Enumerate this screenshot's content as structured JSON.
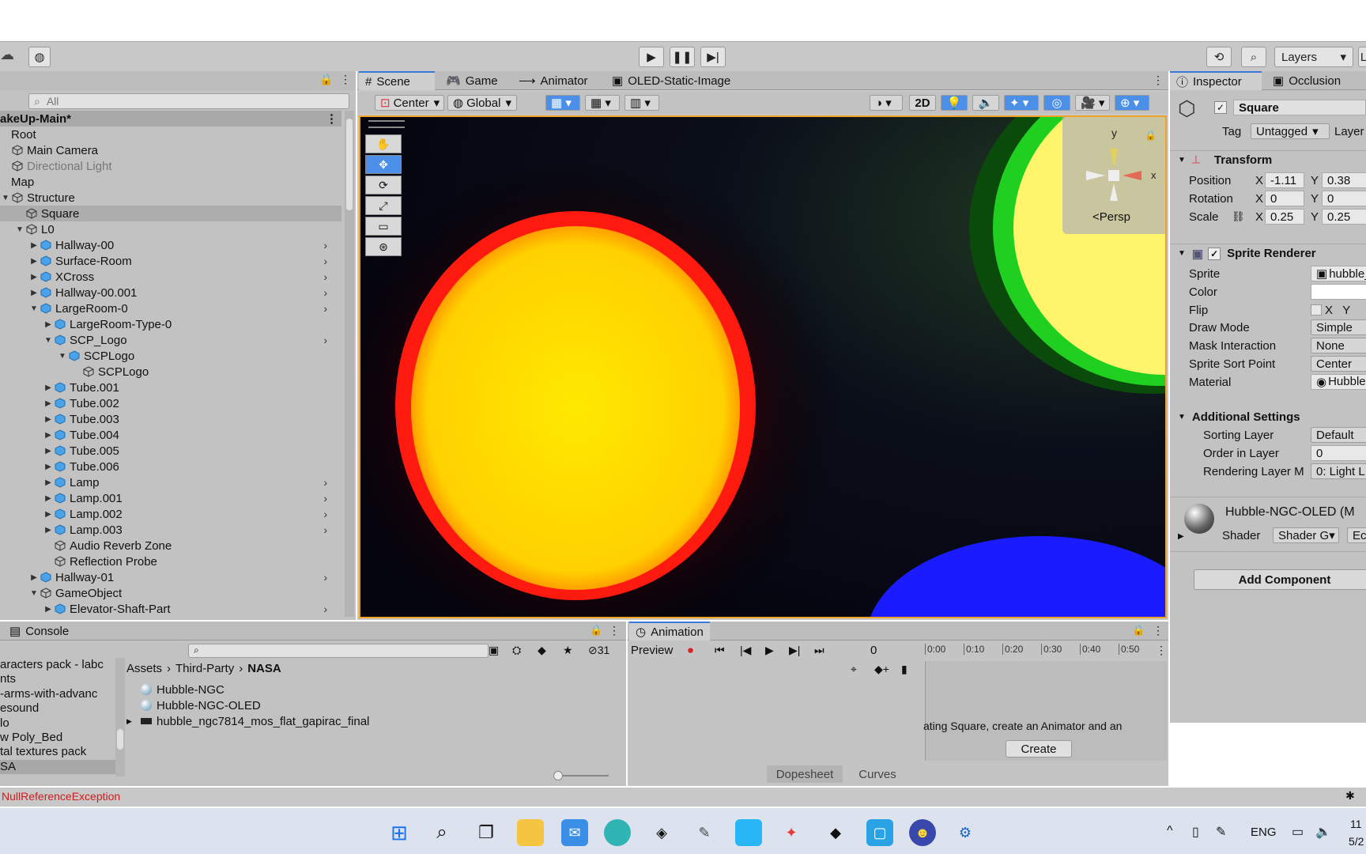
{
  "toolbar": {
    "layers_label": "Layers",
    "play_icon": "play-icon",
    "pause_icon": "pause-icon",
    "step_icon": "step-icon"
  },
  "hierarchy": {
    "search_placeholder": "All",
    "scene_name": "akeUp-Main*",
    "items": [
      {
        "label": "Root",
        "indent": 0,
        "arrow": "",
        "kind": "none",
        "more": false,
        "dim": false
      },
      {
        "label": "Main Camera",
        "indent": 0,
        "arrow": "",
        "kind": "cube",
        "more": false,
        "dim": false
      },
      {
        "label": "Directional Light",
        "indent": 0,
        "arrow": "",
        "kind": "cube",
        "more": false,
        "dim": true
      },
      {
        "label": "Map",
        "indent": 0,
        "arrow": "",
        "kind": "none",
        "more": false,
        "dim": false
      },
      {
        "label": "Structure",
        "indent": 0,
        "arrow": "▼",
        "kind": "cube",
        "more": false,
        "dim": false
      },
      {
        "label": "Square",
        "indent": 1,
        "arrow": "",
        "kind": "cube",
        "more": false,
        "dim": false,
        "selected": true
      },
      {
        "label": "L0",
        "indent": 1,
        "arrow": "▼",
        "kind": "cube",
        "more": false,
        "dim": false
      },
      {
        "label": "Hallway-00",
        "indent": 2,
        "arrow": "▶",
        "kind": "prefab",
        "more": true,
        "dim": false
      },
      {
        "label": "Surface-Room",
        "indent": 2,
        "arrow": "▶",
        "kind": "prefab",
        "more": true,
        "dim": false
      },
      {
        "label": "XCross",
        "indent": 2,
        "arrow": "▶",
        "kind": "prefab",
        "more": true,
        "dim": false
      },
      {
        "label": "Hallway-00.001",
        "indent": 2,
        "arrow": "▶",
        "kind": "prefab",
        "more": true,
        "dim": false
      },
      {
        "label": "LargeRoom-0",
        "indent": 2,
        "arrow": "▼",
        "kind": "prefab",
        "more": true,
        "dim": false
      },
      {
        "label": "LargeRoom-Type-0",
        "indent": 3,
        "arrow": "▶",
        "kind": "prefab",
        "more": false,
        "dim": false
      },
      {
        "label": "SCP_Logo",
        "indent": 3,
        "arrow": "▼",
        "kind": "prefab",
        "more": true,
        "dim": false
      },
      {
        "label": "SCPLogo",
        "indent": 4,
        "arrow": "▼",
        "kind": "prefab",
        "more": false,
        "dim": false
      },
      {
        "label": "SCPLogo",
        "indent": 5,
        "arrow": "",
        "kind": "cube",
        "more": false,
        "dim": false
      },
      {
        "label": "Tube.001",
        "indent": 3,
        "arrow": "▶",
        "kind": "prefab",
        "more": false,
        "dim": false
      },
      {
        "label": "Tube.002",
        "indent": 3,
        "arrow": "▶",
        "kind": "prefab",
        "more": false,
        "dim": false
      },
      {
        "label": "Tube.003",
        "indent": 3,
        "arrow": "▶",
        "kind": "prefab",
        "more": false,
        "dim": false
      },
      {
        "label": "Tube.004",
        "indent": 3,
        "arrow": "▶",
        "kind": "prefab",
        "more": false,
        "dim": false
      },
      {
        "label": "Tube.005",
        "indent": 3,
        "arrow": "▶",
        "kind": "prefab",
        "more": false,
        "dim": false
      },
      {
        "label": "Tube.006",
        "indent": 3,
        "arrow": "▶",
        "kind": "prefab",
        "more": false,
        "dim": false
      },
      {
        "label": "Lamp",
        "indent": 3,
        "arrow": "▶",
        "kind": "prefab",
        "more": true,
        "dim": false
      },
      {
        "label": "Lamp.001",
        "indent": 3,
        "arrow": "▶",
        "kind": "prefab",
        "more": true,
        "dim": false
      },
      {
        "label": "Lamp.002",
        "indent": 3,
        "arrow": "▶",
        "kind": "prefab",
        "more": true,
        "dim": false
      },
      {
        "label": "Lamp.003",
        "indent": 3,
        "arrow": "▶",
        "kind": "prefab",
        "more": true,
        "dim": false
      },
      {
        "label": "Audio Reverb Zone",
        "indent": 3,
        "arrow": "",
        "kind": "cube",
        "more": false,
        "dim": false
      },
      {
        "label": "Reflection Probe",
        "indent": 3,
        "arrow": "",
        "kind": "cube",
        "more": false,
        "dim": false
      },
      {
        "label": "Hallway-01",
        "indent": 2,
        "arrow": "▶",
        "kind": "prefab",
        "more": true,
        "dim": false
      },
      {
        "label": "GameObject",
        "indent": 2,
        "arrow": "▼",
        "kind": "cube",
        "more": false,
        "dim": false
      },
      {
        "label": "Elevator-Shaft-Part",
        "indent": 3,
        "arrow": "▶",
        "kind": "prefab",
        "more": true,
        "dim": false
      }
    ]
  },
  "scene_tabs": [
    {
      "label": "Scene",
      "icon": "grid-icon"
    },
    {
      "label": "Game",
      "icon": "gamepad-icon"
    },
    {
      "label": "Animator",
      "icon": "animator-icon"
    },
    {
      "label": "OLED-Static-Image",
      "icon": "lock-icon"
    }
  ],
  "scene_toolbar": {
    "pivot": "Center",
    "space": "Global",
    "mode_2d": "2D"
  },
  "gizmo": {
    "y_label": "y",
    "x_label": "x",
    "projection": "<Persp"
  },
  "inspector": {
    "tab_inspector": "Inspector",
    "tab_occlusion": "Occlusion",
    "object_name": "Square",
    "tag_label": "Tag",
    "tag_value": "Untagged",
    "layer_label": "Layer",
    "transform": {
      "title": "Transform",
      "rows": [
        {
          "label": "Position",
          "x": "-1.11",
          "y": "0.38"
        },
        {
          "label": "Rotation",
          "x": "0",
          "y": "0"
        },
        {
          "label": "Scale",
          "x": "0.25",
          "y": "0.25"
        }
      ],
      "x_axis": "X",
      "y_axis": "Y"
    },
    "sprite_renderer": {
      "title": "Sprite Renderer",
      "rows": [
        {
          "label": "Sprite",
          "value": "hubble_"
        },
        {
          "label": "Color",
          "value": ""
        },
        {
          "label": "Flip",
          "value": "X   Y"
        },
        {
          "label": "Draw Mode",
          "value": "Simple"
        },
        {
          "label": "Mask Interaction",
          "value": "None"
        },
        {
          "label": "Sprite Sort Point",
          "value": "Center"
        },
        {
          "label": "Material",
          "value": "Hubble"
        }
      ],
      "additional_title": "Additional Settings",
      "additional_rows": [
        {
          "label": "Sorting Layer",
          "value": "Default"
        },
        {
          "label": "Order in Layer",
          "value": "0"
        },
        {
          "label": "Rendering Layer M",
          "value": "0: Light L"
        }
      ]
    },
    "material": {
      "name": "Hubble-NGC-OLED (M",
      "shader_label": "Shader",
      "shader_value": "Shader G",
      "edit_label": "Ec"
    },
    "add_component": "Add Component"
  },
  "console": {
    "tab": "Console",
    "hidden_count": "31",
    "folders": [
      "aracters pack - labc",
      "nts",
      "-arms-with-advanc",
      "esound",
      "lo",
      "w Poly_Bed",
      "tal textures pack",
      "SA"
    ],
    "breadcrumb": [
      "Assets",
      "Third-Party",
      "NASA"
    ],
    "assets": [
      {
        "label": "Hubble-NGC",
        "icon": "material-icon"
      },
      {
        "label": "Hubble-NGC-OLED",
        "icon": "material-icon"
      },
      {
        "label": "hubble_ngc7814_mos_flat_gapirac_final",
        "icon": "texture-icon"
      }
    ],
    "error": "NullReferenceException"
  },
  "animation": {
    "tab": "Animation",
    "preview": "Preview",
    "frame": "0",
    "timeline_ticks": [
      "0:00",
      "0:10",
      "0:20",
      "0:30",
      "0:40",
      "0:50"
    ],
    "message": "ating Square, create an Animator and an",
    "create": "Create",
    "dopesheet": "Dopesheet",
    "curves": "Curves"
  },
  "taskbar": {
    "language": "ENG",
    "time": "11",
    "date": "5/2"
  },
  "colors": {
    "accent": "#3a79d8",
    "scene_border": "#f2a223",
    "error_red": "#d11c1c"
  }
}
